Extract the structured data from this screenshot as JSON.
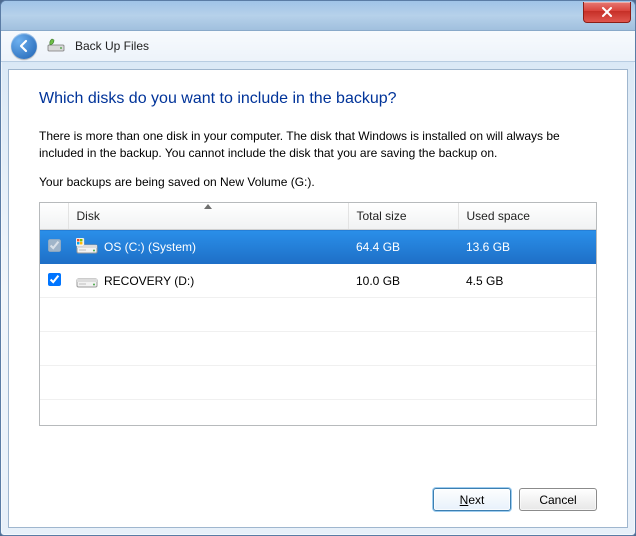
{
  "window": {
    "title": "Back Up Files"
  },
  "page": {
    "heading": "Which disks do you want to include in the backup?",
    "body1": "There is more than one disk in your computer. The disk that Windows is installed on will always be included in the backup. You cannot include the disk that you are saving the backup on.",
    "body2": "Your backups are being saved on New Volume (G:)."
  },
  "table": {
    "columns": {
      "disk": "Disk",
      "total": "Total size",
      "used": "Used space"
    },
    "rows": [
      {
        "name": "OS (C:) (System)",
        "total": "64.4 GB",
        "used": "13.6 GB",
        "checked": true,
        "enabled": false,
        "selected": true,
        "system": true
      },
      {
        "name": "RECOVERY (D:)",
        "total": "10.0 GB",
        "used": "4.5 GB",
        "checked": true,
        "enabled": true,
        "selected": false,
        "system": false
      }
    ]
  },
  "footer": {
    "next": "Next",
    "cancel": "Cancel"
  }
}
